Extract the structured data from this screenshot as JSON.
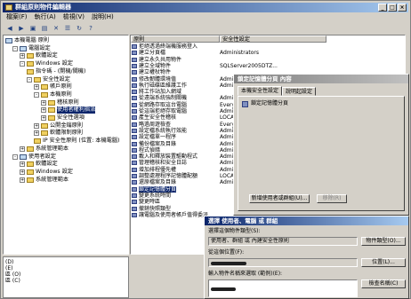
{
  "window": {
    "title": "群組原則物件編輯器",
    "min": "_",
    "max": "□",
    "close": "×"
  },
  "menu": [
    "檔案(F)",
    "執行(A)",
    "檢視(V)",
    "說明(H)"
  ],
  "tree": [
    {
      "label": "本機電腦 原則",
      "indent": 0,
      "icon": "pc"
    },
    {
      "label": "電腦設定",
      "indent": 1,
      "box": "-",
      "icon": "pc"
    },
    {
      "label": "軟體設定",
      "indent": 2,
      "box": "+",
      "icon": "fold"
    },
    {
      "label": "Windows 設定",
      "indent": 2,
      "box": "-",
      "icon": "fold"
    },
    {
      "label": "指令碼 - (開機/關機)",
      "indent": 3,
      "icon": "fold"
    },
    {
      "label": "安全性設定",
      "indent": 3,
      "box": "-",
      "icon": "fold"
    },
    {
      "label": "帳戶原則",
      "indent": 4,
      "box": "+",
      "icon": "fold"
    },
    {
      "label": "本機原則",
      "indent": 4,
      "box": "-",
      "icon": "fold"
    },
    {
      "label": "稽核原則",
      "indent": 5,
      "box": "+",
      "icon": "fold"
    },
    {
      "label": "使用者權利指派",
      "indent": 5,
      "box": "+",
      "icon": "fold",
      "selected": true
    },
    {
      "label": "安全性選項",
      "indent": 5,
      "box": "+",
      "icon": "fold"
    },
    {
      "label": "公開金鑰原則",
      "indent": 4,
      "box": "+",
      "icon": "fold"
    },
    {
      "label": "軟體限制原則",
      "indent": 4,
      "box": "+",
      "icon": "fold"
    },
    {
      "label": "IP 安全性原則 (位置: 本機電腦)",
      "indent": 4,
      "icon": "fold"
    },
    {
      "label": "系統管理範本",
      "indent": 2,
      "box": "+",
      "icon": "fold"
    },
    {
      "label": "使用者設定",
      "indent": 1,
      "box": "-",
      "icon": "pc"
    },
    {
      "label": "軟體設定",
      "indent": 2,
      "box": "+",
      "icon": "fold"
    },
    {
      "label": "Windows 設定",
      "indent": 2,
      "box": "+",
      "icon": "fold"
    },
    {
      "label": "系統管理範本",
      "indent": 2,
      "box": "+",
      "icon": "fold"
    }
  ],
  "list_headers": [
    "原則",
    "安全性設定"
  ],
  "policies": [
    {
      "policy": "拒絕透過終端機服務登入",
      "setting": ""
    },
    {
      "policy": "建立分頁檔",
      "setting": "Administrators"
    },
    {
      "policy": "建立永久共用物件",
      "setting": ""
    },
    {
      "policy": "建立全域物件",
      "setting": "SQLServer2005DTZ..."
    },
    {
      "policy": "建立權杖物件",
      "setting": ""
    },
    {
      "policy": "修改韌體環境值",
      "setting": "Admin"
    },
    {
      "policy": "執行磁碟區維護工作",
      "setting": "Admin"
    },
    {
      "policy": "將工作站加入網域",
      "setting": ""
    },
    {
      "policy": "從遠端系統強制關機",
      "setting": "Admin"
    },
    {
      "policy": "從網路存取這台電腦",
      "setting": "Every"
    },
    {
      "policy": "從這端拒絕存取電腦",
      "setting": "Admin"
    },
    {
      "policy": "產生安全性稽核",
      "setting": "LOCA"
    },
    {
      "policy": "略過周遊檢查",
      "setting": "Every"
    },
    {
      "policy": "設定檔系統執行效能",
      "setting": "Admin"
    },
    {
      "policy": "設定檔單一程序",
      "setting": "Admin"
    },
    {
      "policy": "備份檔案及目錄",
      "setting": "Admin"
    },
    {
      "policy": "程式偵錯",
      "setting": "Admin"
    },
    {
      "policy": "載入和釋放裝置驅動程式",
      "setting": "Admin"
    },
    {
      "policy": "管理稽核和安全日誌",
      "setting": "Admin"
    },
    {
      "policy": "增加排程優先權",
      "setting": "Admin"
    },
    {
      "policy": "調整處理程序記憶體配額",
      "setting": "LOCA"
    },
    {
      "policy": "還原檔案及目錄",
      "setting": "Admin"
    },
    {
      "policy": "鎖定記憶體分頁",
      "setting": ""
    },
    {
      "policy": "變更系統時間",
      "setting": ""
    },
    {
      "policy": "變更時區",
      "setting": ""
    },
    {
      "policy": "撤銷快照類型",
      "setting": ""
    },
    {
      "policy": "讓電腦及使用者帳戶值得委派",
      "setting": ""
    }
  ],
  "bottom_lines": [
    "(D)",
    "(E)",
    "區 (O)",
    "區 (C)"
  ],
  "prop_dialog": {
    "title": "鎖定記憶體分頁 內容",
    "tabs": [
      "本機安全性設定",
      "說明起設定"
    ],
    "item_label": "鎖定記憶體分頁",
    "add_button": "新增使用者或群組(U)...",
    "remove_button": "移除(R)"
  },
  "select_dialog": {
    "title": "選擇 使用者、電腦 或 群組",
    "type_label": "選擇這個物件類型(S):",
    "type_value": "使用者、群組 或 內建安全性原則",
    "type_button": "物件類型(O)...",
    "location_label": "從這個位置(F):",
    "location_button": "位置(L)...",
    "names_label": "輸入物件名稱來選取 (範例)(E):",
    "check_button": "檢查名稱(C)"
  },
  "colors": {
    "title_active": "#0a246a",
    "title_inactive": "#808080",
    "face": "#d4d0c8"
  }
}
